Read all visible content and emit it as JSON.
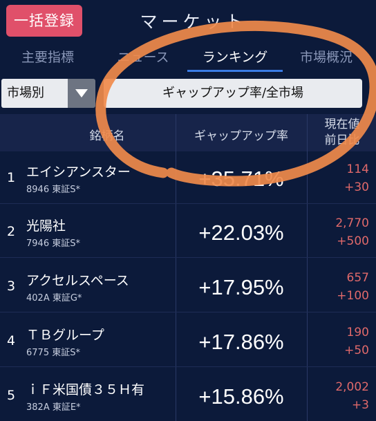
{
  "header": {
    "register_button": "一括登録",
    "title": "マーケット"
  },
  "tabs": [
    {
      "label": "主要指標",
      "active": false
    },
    {
      "label": "ニュース",
      "active": false
    },
    {
      "label": "ランキング",
      "active": true
    },
    {
      "label": "市場概況",
      "active": false
    }
  ],
  "filters": {
    "market_select": "市場別",
    "ranking_select": "ギャップアップ率/全市場"
  },
  "table": {
    "col_name": "銘柄名",
    "col_gap": "ギャップアップ率",
    "col_price_line1": "現在値",
    "col_price_line2": "前日比",
    "rows": [
      {
        "rank": "1",
        "name": "エイシアンスター",
        "code": "8946 東証S*",
        "gap": "+35.71%",
        "price": "114",
        "change": "+30"
      },
      {
        "rank": "2",
        "name": "光陽社",
        "code": "7946 東証S*",
        "gap": "+22.03%",
        "price": "2,770",
        "change": "+500"
      },
      {
        "rank": "3",
        "name": "アクセルスペース",
        "code": "402A 東証G*",
        "gap": "+17.95%",
        "price": "657",
        "change": "+100"
      },
      {
        "rank": "4",
        "name": "ＴＢグループ",
        "code": "6775 東証S*",
        "gap": "+17.86%",
        "price": "190",
        "change": "+50"
      },
      {
        "rank": "5",
        "name": "ｉＦ米国債３５Ｈ有",
        "code": "382A 東証E*",
        "gap": "+15.86%",
        "price": "2,002",
        "change": "+3"
      }
    ]
  },
  "colors": {
    "background": "#0c1a3a",
    "register_button": "#e0506a",
    "active_tab_underline": "#3a7ce6",
    "positive": "#e0696a",
    "annotation": "#f08a4b"
  }
}
